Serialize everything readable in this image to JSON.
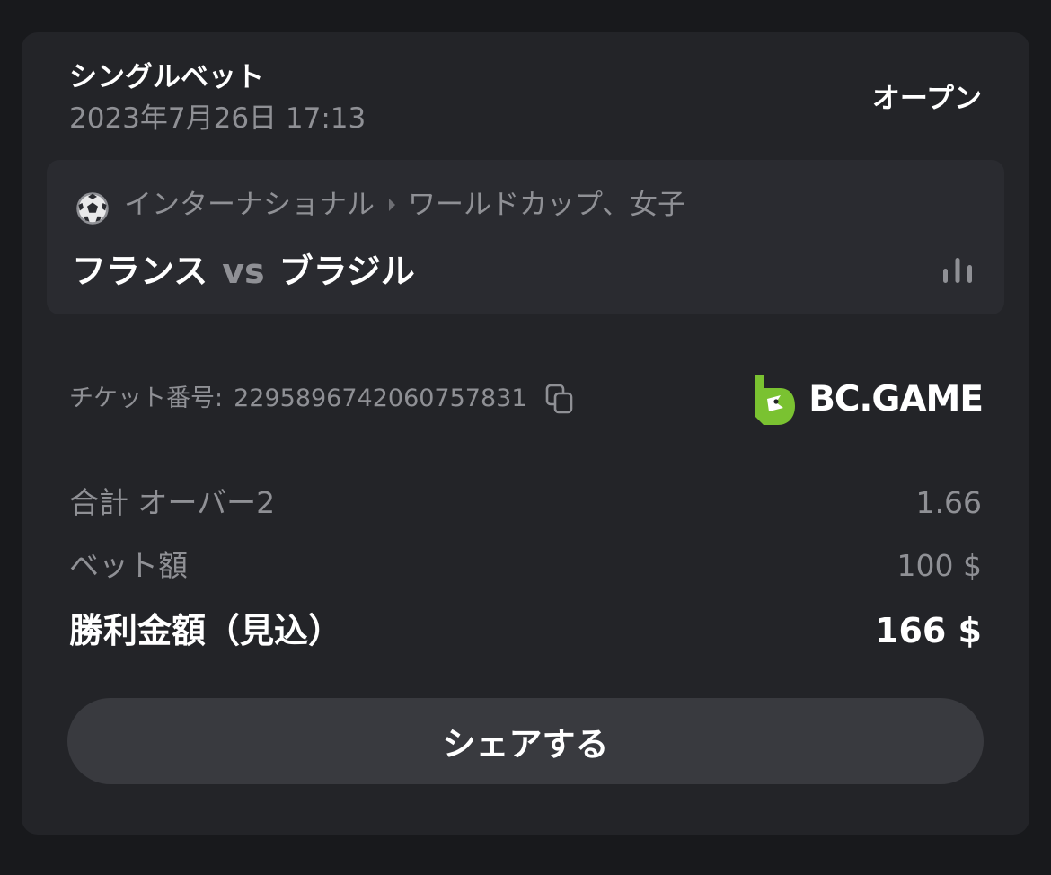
{
  "bet": {
    "title": "シングルベット",
    "date": "2023年7月26日 17:13",
    "status": "オープン"
  },
  "event": {
    "sport_icon": "soccer-ball-icon",
    "breadcrumb": [
      "インターナショナル",
      "ワールドカップ、女子"
    ],
    "home_team": "フランス",
    "vs": "vs",
    "away_team": "ブラジル",
    "stats_icon": "stats-bars-icon"
  },
  "ticket": {
    "label": "チケット番号:",
    "number": "2295896742060757831",
    "copy_icon": "copy-icon"
  },
  "brand": {
    "name": "BC.GAME",
    "logo_color": "#7ac231"
  },
  "details": {
    "market_label": "合計 オーバー2",
    "market_odds": "1.66",
    "stake_label": "ベット額",
    "stake_value": "100 $",
    "payout_label": "勝利金額（見込）",
    "payout_value": "166 $"
  },
  "share_button": {
    "label": "シェアする"
  },
  "colors": {
    "background": "#18191c",
    "card": "#232428",
    "event_box": "#2a2b30",
    "button": "#393a3f",
    "muted_text": "#8f9095",
    "text": "#ffffff",
    "brand_green": "#7ac231"
  }
}
